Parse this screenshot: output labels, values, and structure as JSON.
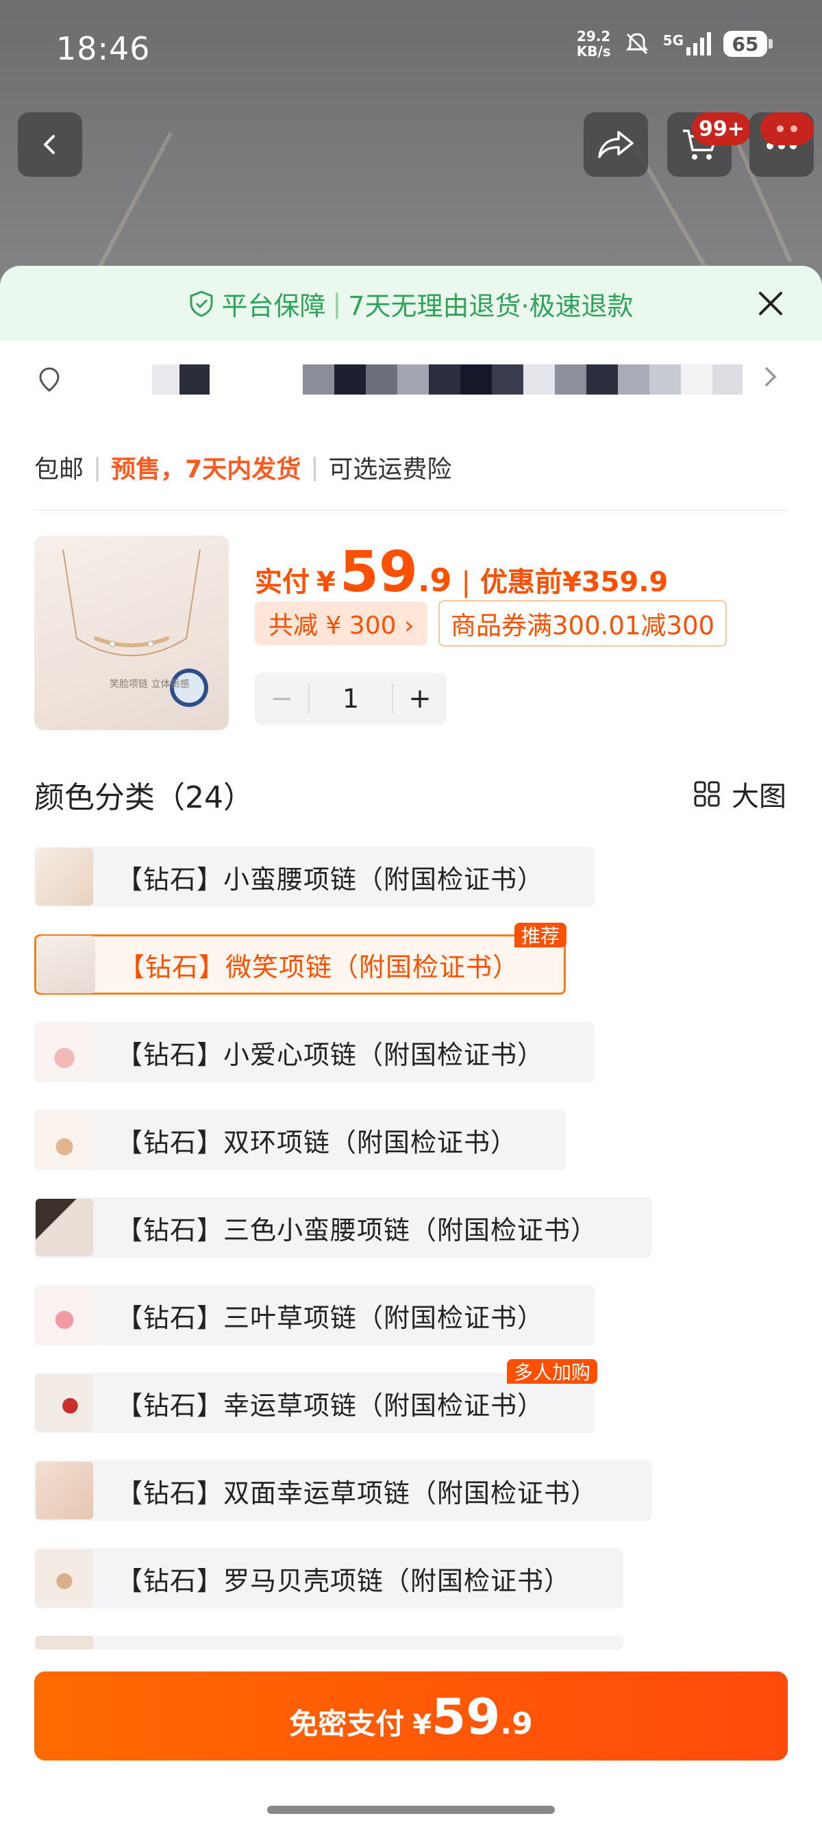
{
  "status": {
    "time": "18:46",
    "net_speed_value": "29.2",
    "net_speed_unit": "KB/s",
    "network": "5G",
    "battery": "65"
  },
  "header": {
    "cart_badge": "99+"
  },
  "sheet": {
    "guarantee": {
      "part1": "平台保障",
      "part2": "7天无理由退货·极速退款"
    },
    "shipping": {
      "free": "包邮",
      "presale": "预售，7天内发货",
      "insurance": "可选运费险"
    },
    "price": {
      "paid_label": "实付",
      "currency": "¥",
      "paid_int": "59",
      "paid_dec": ".9",
      "original_label": "优惠前",
      "original": "¥359.9"
    },
    "savings_tag": "共减 ¥ 300 ›",
    "coupon_tag": "商品券满300.01减300",
    "quantity": {
      "minus": "−",
      "value": "1",
      "plus": "+"
    },
    "product_image_caption": "笑脸项链 立体质感",
    "options_title": "颜色分类（24）",
    "big_view_label": "大图",
    "options": [
      {
        "label": "【钻石】小蛮腰项链（附国检证书）",
        "selected": false,
        "badge": ""
      },
      {
        "label": "【钻石】微笑项链（附国检证书）",
        "selected": true,
        "badge": "推荐"
      },
      {
        "label": "【钻石】小爱心项链（附国检证书）",
        "selected": false,
        "badge": ""
      },
      {
        "label": "【钻石】双环项链（附国检证书）",
        "selected": false,
        "badge": ""
      },
      {
        "label": "【钻石】三色小蛮腰项链（附国检证书）",
        "selected": false,
        "badge": ""
      },
      {
        "label": "【钻石】三叶草项链（附国检证书）",
        "selected": false,
        "badge": ""
      },
      {
        "label": "【钻石】幸运草项链（附国检证书）",
        "selected": false,
        "badge": "多人加购"
      },
      {
        "label": "【钻石】双面幸运草项链（附国检证书）",
        "selected": false,
        "badge": ""
      },
      {
        "label": "【钻石】罗马贝壳项链（附国检证书）",
        "selected": false,
        "badge": ""
      }
    ],
    "pay_button": {
      "label": "免密支付",
      "currency": "¥",
      "amount_int": "59",
      "amount_dec": ".9"
    }
  },
  "colors": {
    "accent": "#ff5000",
    "guarantee_green": "#2fa35a",
    "guarantee_bg": "#eaf8ee"
  }
}
